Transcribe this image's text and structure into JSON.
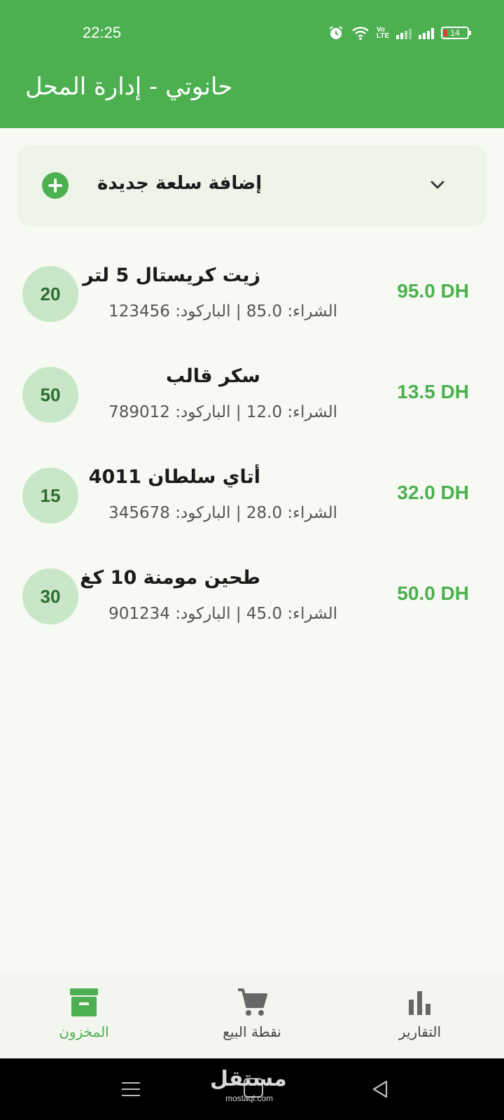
{
  "status_bar": {
    "time": "22:25",
    "battery": "14"
  },
  "app_bar": {
    "title": "حانوتي - إدارة المحل"
  },
  "add_item": {
    "label": "إضافة سلعة جديدة"
  },
  "products": [
    {
      "name": "زيت كريستال 5 لتر",
      "details": "الشراء: 85.0 | الباركود: 123456",
      "price": "95.0 DH",
      "quantity": "20"
    },
    {
      "name": "سكر قالب",
      "details": "الشراء: 12.0 | الباركود: 789012",
      "price": "13.5 DH",
      "quantity": "50"
    },
    {
      "name": "أتاي سلطان 4011",
      "details": "الشراء: 28.0 | الباركود: 345678",
      "price": "32.0 DH",
      "quantity": "15"
    },
    {
      "name": "طحين مومنة 10 كغ",
      "details": "الشراء: 45.0 | الباركود: 901234",
      "price": "50.0 DH",
      "quantity": "30"
    }
  ],
  "bottom_nav": {
    "inventory": "المخزون",
    "point_of_sale": "نقطة البيع",
    "reports": "التقارير",
    "active": "inventory"
  },
  "watermark": {
    "logo_text": "مستقل",
    "sub": "mostaql.com"
  },
  "colors": {
    "primary": "#4caf50",
    "background": "#f7faf3",
    "quantity_badge": "#c9e6c8"
  }
}
